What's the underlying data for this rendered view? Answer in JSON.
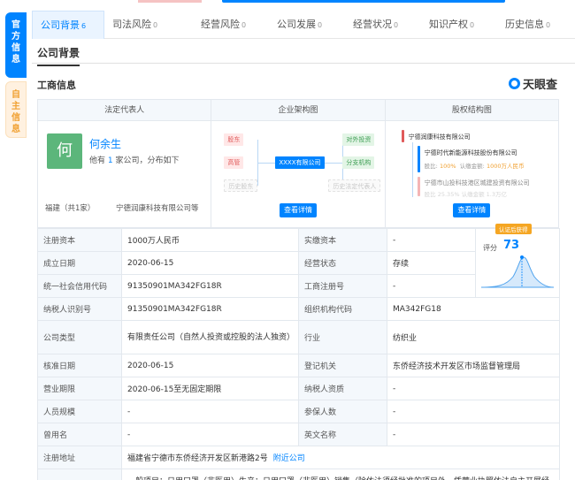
{
  "side_tabs": [
    {
      "label": "官方信息",
      "chars": [
        "官",
        "方",
        "信",
        "息"
      ]
    },
    {
      "label": "自主信息",
      "chars": [
        "自",
        "主",
        "信",
        "息"
      ]
    }
  ],
  "tabs": [
    {
      "label": "公司背景",
      "count": "6"
    },
    {
      "label": "司法风险",
      "count": "0"
    },
    {
      "label": "经营风险",
      "count": "0"
    },
    {
      "label": "公司发展",
      "count": "0"
    },
    {
      "label": "经营状况",
      "count": "0"
    },
    {
      "label": "知识产权",
      "count": "0"
    },
    {
      "label": "历史信息",
      "count": "0"
    }
  ],
  "section_title": "公司背景",
  "sub_title": "工商信息",
  "brand": "天眼查",
  "info_box": {
    "headers": [
      "法定代表人",
      "企业架构图",
      "股权结构图"
    ],
    "legal_rep": {
      "avatar_char": "何",
      "name": "何余生",
      "desc_prefix": "他有",
      "desc_num": "1",
      "desc_suffix": "家公司，分布如下",
      "region": "福建（共1家）",
      "company": "宁德润康科技有限公司等"
    },
    "org_chart": {
      "left_nodes": [
        "股东",
        "高管",
        "历史股东"
      ],
      "center_node": "XXXX有限公司",
      "right_nodes": [
        "对外投资",
        "分支机构",
        "历史法定代表人"
      ],
      "button": "查看详情"
    },
    "equity_chart": {
      "root": "宁德润康科技有限公司",
      "item1": "宁德时代新能源科技股份有限公司",
      "item1_ratio_label": "股比:",
      "item1_ratio": "100%",
      "item1_capital_label": "认缴金额:",
      "item1_capital": "1000万人民币",
      "item2": "宁德市山投科技港区城建投资有限公司",
      "item2_faint": "股比 25.35%   认缴金额 1.3万亿",
      "button": "查看详情"
    }
  },
  "table": [
    {
      "l1": "注册资本",
      "v1": "1000万人民币",
      "l2": "实缴资本",
      "v2": "-"
    },
    {
      "l1": "成立日期",
      "v1": "2020-06-15",
      "l2": "经营状态",
      "v2": "存续"
    },
    {
      "l1": "统一社会信用代码",
      "v1": "91350901MA342FG18R",
      "l2": "工商注册号",
      "v2": "-"
    },
    {
      "l1": "纳税人识别号",
      "v1": "91350901MA342FG18R",
      "l2": "组织机构代码",
      "v2": "MA342FG18"
    },
    {
      "l1": "公司类型",
      "v1": "有限责任公司（自然人投资或控股的法人独资）",
      "l2": "行业",
      "v2": "纺织业"
    },
    {
      "l1": "核准日期",
      "v1": "2020-06-15",
      "l2": "登记机关",
      "v2": "东侨经济技术开发区市场监督管理局"
    },
    {
      "l1": "营业期限",
      "v1": "2020-06-15至无固定期限",
      "l2": "纳税人资质",
      "v2": "-"
    },
    {
      "l1": "人员规模",
      "v1": "-",
      "l2": "参保人数",
      "v2": "-"
    },
    {
      "l1": "曾用名",
      "v1": "-",
      "l2": "英文名称",
      "v2": "-"
    },
    {
      "l1": "注册地址",
      "v1": "福建省宁德市东侨经济开发区新港路2号",
      "link": "附近公司"
    },
    {
      "l1": "",
      "v1": "一般项目：日用口罩（非医用）生产；日用口罩（非医用）销售（除依法须经批准的项目外，凭营业执照依法自主开展经"
    }
  ],
  "score": {
    "badge": "认证后获得",
    "label": "评分",
    "value": "73"
  },
  "colors": {
    "accent": "#0084ff",
    "legal_avatar": "#5cb67b",
    "badge_orange": "#f5a623"
  }
}
